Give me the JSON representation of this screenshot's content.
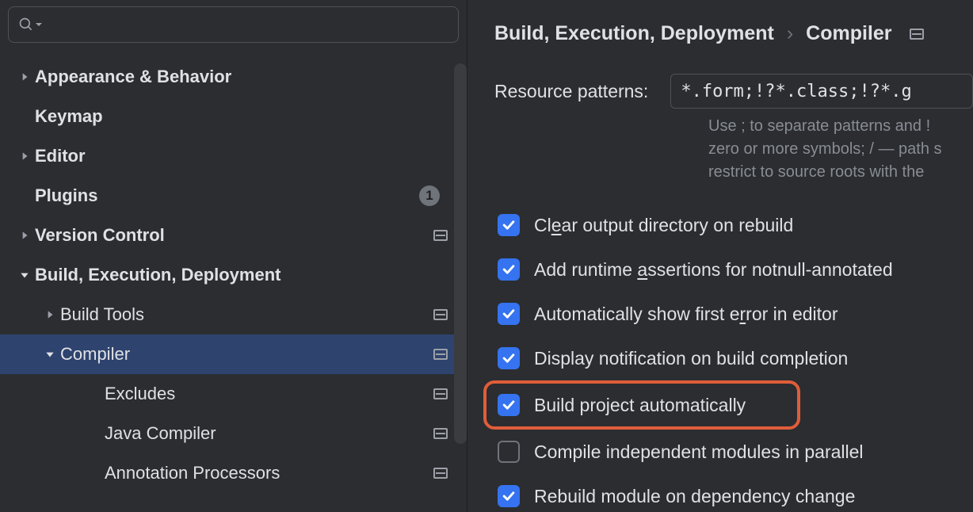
{
  "search": {
    "placeholder": ""
  },
  "sidebar": {
    "items": [
      {
        "label": "Appearance & Behavior",
        "indent": 0,
        "arrow": "right",
        "bold": true,
        "badge": null,
        "proj": false,
        "selected": false
      },
      {
        "label": "Keymap",
        "indent": 0,
        "arrow": "none",
        "bold": true,
        "badge": null,
        "proj": false,
        "selected": false
      },
      {
        "label": "Editor",
        "indent": 0,
        "arrow": "right",
        "bold": true,
        "badge": null,
        "proj": false,
        "selected": false
      },
      {
        "label": "Plugins",
        "indent": 0,
        "arrow": "none",
        "bold": true,
        "badge": "1",
        "proj": false,
        "selected": false
      },
      {
        "label": "Version Control",
        "indent": 0,
        "arrow": "right",
        "bold": true,
        "badge": null,
        "proj": true,
        "selected": false
      },
      {
        "label": "Build, Execution, Deployment",
        "indent": 0,
        "arrow": "down",
        "bold": true,
        "badge": null,
        "proj": false,
        "selected": false
      },
      {
        "label": "Build Tools",
        "indent": 1,
        "arrow": "right",
        "bold": false,
        "badge": null,
        "proj": true,
        "selected": false
      },
      {
        "label": "Compiler",
        "indent": 1,
        "arrow": "down",
        "bold": false,
        "badge": null,
        "proj": true,
        "selected": true
      },
      {
        "label": "Excludes",
        "indent": 2,
        "arrow": "none",
        "bold": false,
        "badge": null,
        "proj": true,
        "selected": false
      },
      {
        "label": "Java Compiler",
        "indent": 2,
        "arrow": "none",
        "bold": false,
        "badge": null,
        "proj": true,
        "selected": false
      },
      {
        "label": "Annotation Processors",
        "indent": 2,
        "arrow": "none",
        "bold": false,
        "badge": null,
        "proj": true,
        "selected": false
      }
    ]
  },
  "panel": {
    "breadcrumb": {
      "parent": "Build, Execution, Deployment",
      "current": "Compiler"
    },
    "resource_label": "Resource patterns:",
    "resource_value": "*.form;!?*.class;!?*.g",
    "hint_l1": "Use ; to separate patterns and ! ",
    "hint_l2": "zero or more symbols; / — path s",
    "hint_l3": "restrict to source roots with the ",
    "checks": [
      {
        "label_pre": "Cl",
        "label_u": "e",
        "label_post": "ar output directory on rebuild",
        "checked": true,
        "highlighted": false
      },
      {
        "label_pre": "Add runtime ",
        "label_u": "a",
        "label_post": "ssertions for notnull-annotated ",
        "checked": true,
        "highlighted": false
      },
      {
        "label_pre": "Automatically show first e",
        "label_u": "r",
        "label_post": "ror in editor",
        "checked": true,
        "highlighted": false
      },
      {
        "label_pre": "Display notification on build completion",
        "label_u": "",
        "label_post": "",
        "checked": true,
        "highlighted": false
      },
      {
        "label_pre": "Build project automatically",
        "label_u": "",
        "label_post": "",
        "checked": true,
        "highlighted": true
      },
      {
        "label_pre": "Compile independent modules in parallel",
        "label_u": "",
        "label_post": "",
        "checked": false,
        "highlighted": false
      },
      {
        "label_pre": "Rebuild module on dependency change",
        "label_u": "",
        "label_post": "",
        "checked": true,
        "highlighted": false
      }
    ]
  }
}
